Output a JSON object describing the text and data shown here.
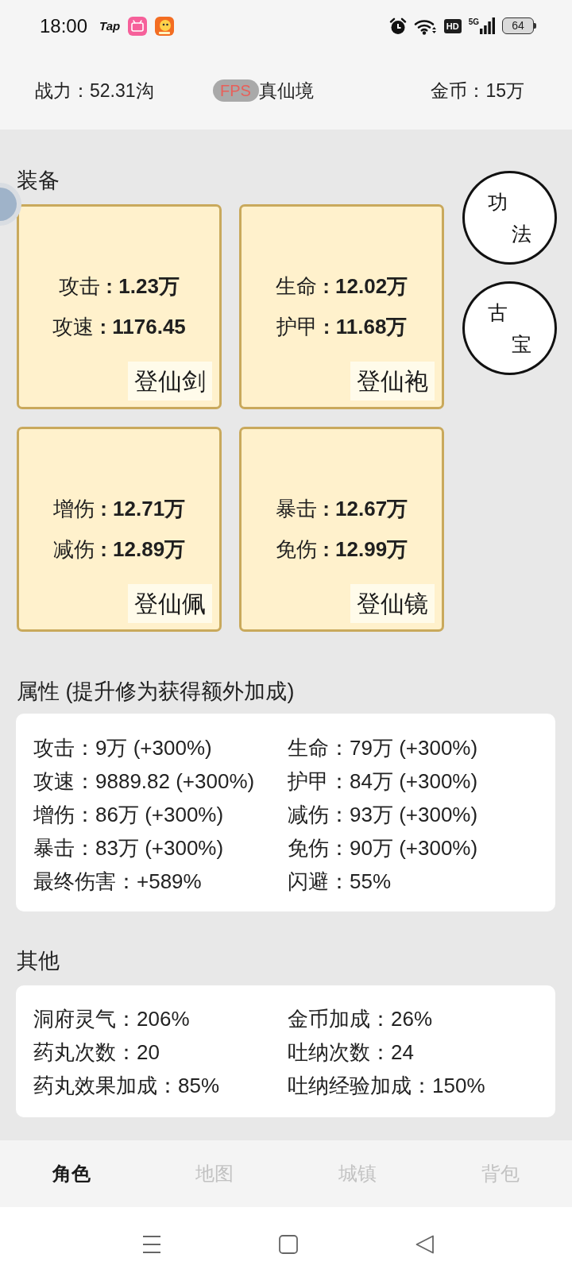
{
  "status_bar": {
    "time": "18:00",
    "tap_logo": "Tap",
    "hd_badge": "HD",
    "network": "5G",
    "battery": "64"
  },
  "header": {
    "combat_power": "战力：52.31沟",
    "fps": "FPS",
    "realm": "真仙境",
    "gold": "金币：15万"
  },
  "equipment": {
    "title": "装备",
    "items": [
      {
        "stats": [
          "攻击 **: 1.23万**",
          "攻速 **: 1176.45**"
        ],
        "name": "登仙剑"
      },
      {
        "stats": [
          "生命 **: 12.02万**",
          "护甲 **: 11.68万**"
        ],
        "name": "登仙袍"
      },
      {
        "stats": [
          "增伤 **: 12.71万**",
          "减伤 **: 12.89万**"
        ],
        "name": "登仙佩"
      },
      {
        "stats": [
          "暴击 **: 12.67万**",
          "免伤 **: 12.99万**"
        ],
        "name": "登仙镜"
      }
    ],
    "side_buttons": [
      {
        "chars": [
          "功",
          "法"
        ]
      },
      {
        "chars": [
          "古",
          "宝"
        ]
      }
    ]
  },
  "attributes": {
    "title": "属性 (提升修为获得额外加成)",
    "entries": [
      "攻击：9万 (+300%)",
      "生命：79万 (+300%)",
      "攻速：9889.82 (+300%)",
      "护甲：84万 (+300%)",
      "增伤：86万 (+300%)",
      "减伤：93万 (+300%)",
      "暴击：83万 (+300%)",
      "免伤：90万 (+300%)",
      "最终伤害：+589%",
      "闪避：55%"
    ]
  },
  "other": {
    "title": "其他",
    "entries": [
      "洞府灵气：206%",
      "金币加成：26%",
      "药丸次数：20",
      "吐纳次数：24",
      "药丸效果加成：85%",
      "吐纳经验加成：150%"
    ]
  },
  "bottom_nav": {
    "tabs": [
      {
        "label": "角色",
        "selected": true
      },
      {
        "label": "地图",
        "selected": false
      },
      {
        "label": "城镇",
        "selected": false
      },
      {
        "label": "背包",
        "selected": false
      }
    ]
  }
}
